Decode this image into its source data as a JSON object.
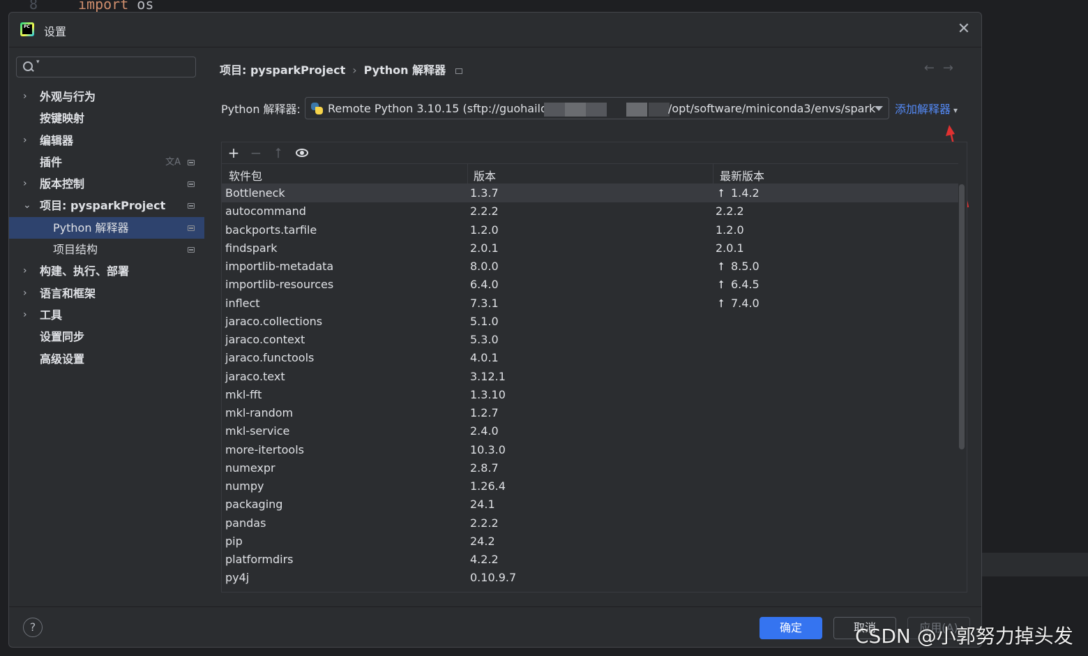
{
  "editor": {
    "line_number": "8",
    "code_keyword": "import",
    "code_module": "os"
  },
  "dialog": {
    "title": "设置",
    "close_icon": "close-icon"
  },
  "sidebar": {
    "search_placeholder": "",
    "items": [
      {
        "label": "外观与行为",
        "expandable": true
      },
      {
        "label": "按键映射",
        "expandable": false
      },
      {
        "label": "编辑器",
        "expandable": true
      },
      {
        "label": "插件",
        "expandable": false,
        "translate_icon": "文A"
      },
      {
        "label": "版本控制",
        "expandable": true
      },
      {
        "label": "项目: pysparkProject",
        "expandable": true,
        "expanded": true
      },
      {
        "label": "Python 解释器",
        "sub": true,
        "selected": true
      },
      {
        "label": "项目结构",
        "sub": true
      },
      {
        "label": "构建、执行、部署",
        "expandable": true
      },
      {
        "label": "语言和框架",
        "expandable": true
      },
      {
        "label": "工具",
        "expandable": true
      },
      {
        "label": "设置同步",
        "expandable": false
      },
      {
        "label": "高级设置",
        "expandable": false
      }
    ]
  },
  "main": {
    "breadcrumb_project": "项目: pysparkProject",
    "breadcrumb_separator": "›",
    "breadcrumb_page": "Python 解释器",
    "nav_back": "←",
    "nav_forward": "→",
    "interpreter_label": "Python 解释器:",
    "interpreter_value_start": "Remote Python 3.10.15 (sftp://guohailo",
    "interpreter_value_end": "/opt/software/miniconda3/envs/spark",
    "add_interpreter": "添加解释器",
    "add_interpreter_chevron": "⌄"
  },
  "toolbar": {
    "add": "+",
    "remove": "−",
    "upgrade": "⭡"
  },
  "table": {
    "columns": [
      "软件包",
      "版本",
      "最新版本"
    ],
    "rows": [
      {
        "package": "Bottleneck",
        "version": "1.3.7",
        "latest": "1.4.2",
        "upgrade": true
      },
      {
        "package": "autocommand",
        "version": "2.2.2",
        "latest": "2.2.2",
        "upgrade": false
      },
      {
        "package": "backports.tarfile",
        "version": "1.2.0",
        "latest": "1.2.0",
        "upgrade": false
      },
      {
        "package": "findspark",
        "version": "2.0.1",
        "latest": "2.0.1",
        "upgrade": false
      },
      {
        "package": "importlib-metadata",
        "version": "8.0.0",
        "latest": "8.5.0",
        "upgrade": true
      },
      {
        "package": "importlib-resources",
        "version": "6.4.0",
        "latest": "6.4.5",
        "upgrade": true
      },
      {
        "package": "inflect",
        "version": "7.3.1",
        "latest": "7.4.0",
        "upgrade": true
      },
      {
        "package": "jaraco.collections",
        "version": "5.1.0",
        "latest": "",
        "upgrade": false
      },
      {
        "package": "jaraco.context",
        "version": "5.3.0",
        "latest": "",
        "upgrade": false
      },
      {
        "package": "jaraco.functools",
        "version": "4.0.1",
        "latest": "",
        "upgrade": false
      },
      {
        "package": "jaraco.text",
        "version": "3.12.1",
        "latest": "",
        "upgrade": false
      },
      {
        "package": "mkl-fft",
        "version": "1.3.10",
        "latest": "",
        "upgrade": false
      },
      {
        "package": "mkl-random",
        "version": "1.2.7",
        "latest": "",
        "upgrade": false
      },
      {
        "package": "mkl-service",
        "version": "2.4.0",
        "latest": "",
        "upgrade": false
      },
      {
        "package": "more-itertools",
        "version": "10.3.0",
        "latest": "",
        "upgrade": false
      },
      {
        "package": "numexpr",
        "version": "2.8.7",
        "latest": "",
        "upgrade": false
      },
      {
        "package": "numpy",
        "version": "1.26.4",
        "latest": "",
        "upgrade": false
      },
      {
        "package": "packaging",
        "version": "24.1",
        "latest": "",
        "upgrade": false
      },
      {
        "package": "pandas",
        "version": "2.2.2",
        "latest": "",
        "upgrade": false
      },
      {
        "package": "pip",
        "version": "24.2",
        "latest": "",
        "upgrade": false
      },
      {
        "package": "platformdirs",
        "version": "4.2.2",
        "latest": "",
        "upgrade": false
      },
      {
        "package": "py4j",
        "version": "0.10.9.7",
        "latest": "",
        "upgrade": false
      }
    ]
  },
  "footer": {
    "help": "?",
    "ok": "确定",
    "cancel": "取消",
    "apply": "应用(A)"
  },
  "watermark": "CSDN @小郭努力掉头发",
  "colors": {
    "accent": "#3574f0",
    "link": "#548af7",
    "selection": "#2e436e",
    "annotation_arrow": "#e03131"
  }
}
